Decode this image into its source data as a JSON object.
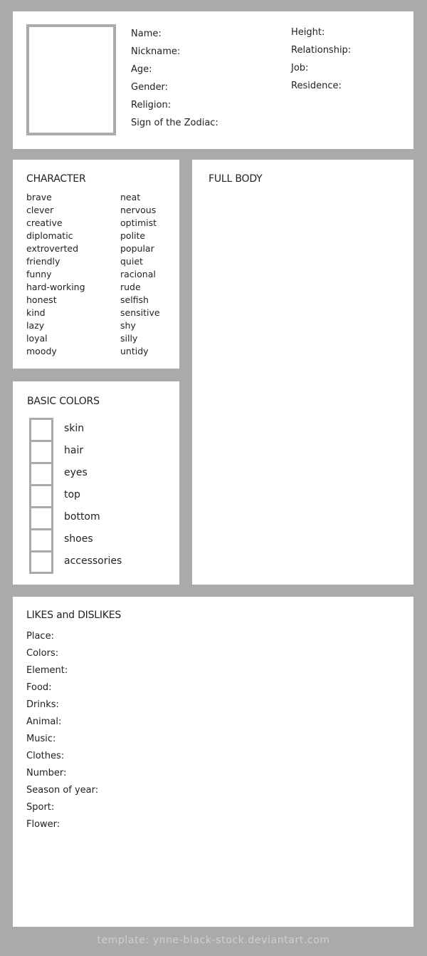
{
  "profile": {
    "left_fields": [
      "Name:",
      "Nickname:",
      "Age:",
      "Gender:",
      "Religion:",
      "Sign of the Zodiac:"
    ],
    "right_fields": [
      "Height:",
      "Relationship:",
      "Job:",
      "Residence:"
    ]
  },
  "character": {
    "title": "CHARACTER",
    "traits_left": [
      "brave",
      "clever",
      "creative",
      "diplomatic",
      "extroverted",
      "friendly",
      "funny",
      "hard-working",
      "honest",
      "kind",
      "lazy",
      "loyal",
      "moody"
    ],
    "traits_right": [
      "neat",
      "nervous",
      "optimist",
      "polite",
      "popular",
      "quiet",
      "racional",
      "rude",
      "selfish",
      "sensitive",
      "shy",
      "silly",
      "untidy"
    ]
  },
  "basic_colors": {
    "title": "BASIC COLORS",
    "items": [
      "skin",
      "hair",
      "eyes",
      "top",
      "bottom",
      "shoes",
      "accessories"
    ]
  },
  "full_body": {
    "title": "FULL BODY"
  },
  "likes": {
    "title": "LIKES and DISLIKES",
    "fields": [
      "Place:",
      "Colors:",
      "Element:",
      "Food:",
      "Drinks:",
      "Animal:",
      "Music:",
      "Clothes:",
      "Number:",
      "Season of year:",
      "Sport:",
      "Flower:"
    ]
  },
  "footer": "template: ynne-black-stock.deviantart.com",
  "colors": {
    "background": "#aaaaaa",
    "panel": "#ffffff",
    "border": "#aaaaaa"
  }
}
